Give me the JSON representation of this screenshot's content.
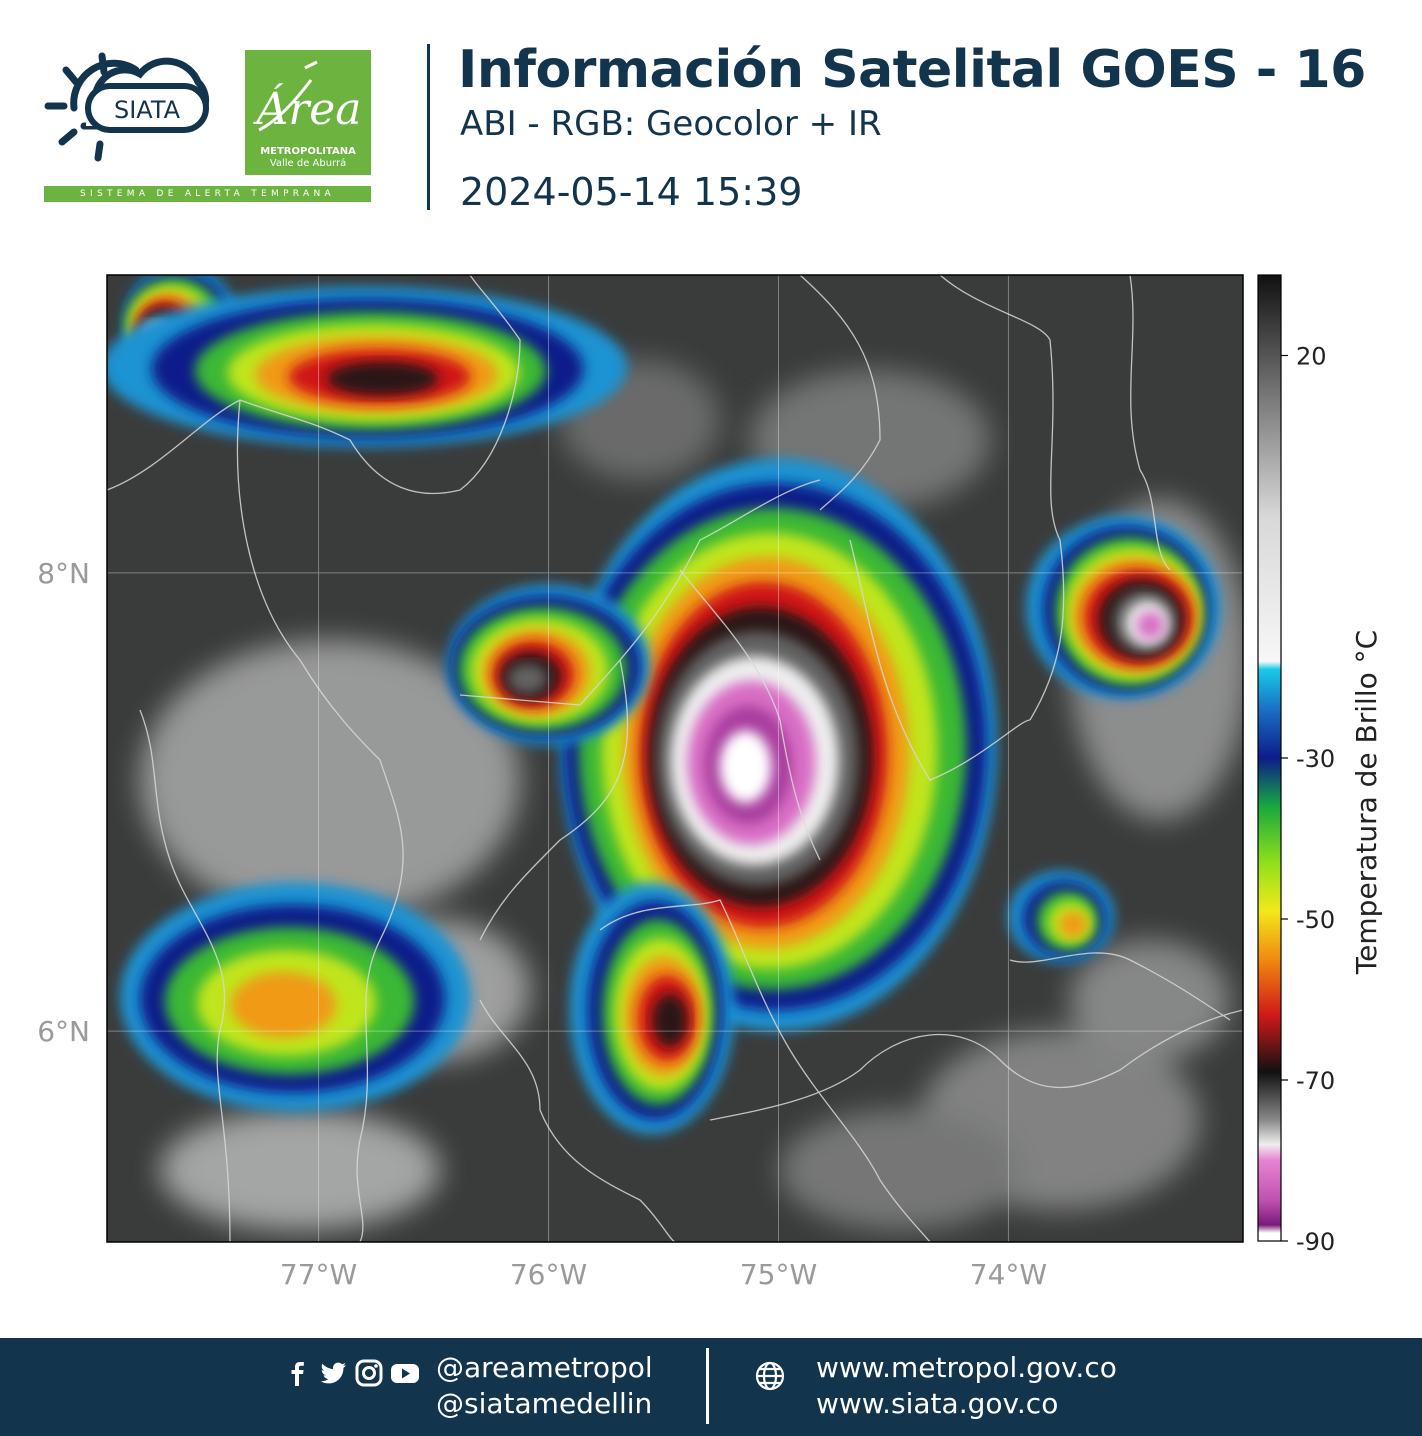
{
  "header": {
    "siata_logo_text": "SIATA",
    "area_logo_word": "Área",
    "area_logo_line1": "METROPOLITANA",
    "area_logo_line2": "Valle de Aburrá",
    "slogan": "SISTEMA DE ALERTA TEMPRANA",
    "title": "Información Satelital GOES - 16",
    "subtitle": "ABI - RGB: Geocolor + IR",
    "datetime": "2024-05-14 15:39"
  },
  "map": {
    "lon_range": [
      -77.92,
      -72.98
    ],
    "lat_range": [
      5.08,
      9.3
    ],
    "x_ticks": [
      {
        "value": -77,
        "label": "77°W"
      },
      {
        "value": -76,
        "label": "76°W"
      },
      {
        "value": -75,
        "label": "75°W"
      },
      {
        "value": -74,
        "label": "74°W"
      }
    ],
    "y_ticks": [
      {
        "value": 8,
        "label": "8°N"
      },
      {
        "value": 6,
        "label": "6°N"
      }
    ],
    "grid": true,
    "cloud_cells": [
      {
        "lon": -75.0,
        "lat": 7.25,
        "rx": 0.95,
        "ry": 1.25,
        "min_temp": -90
      },
      {
        "lon": -73.5,
        "lat": 7.85,
        "rx": 0.42,
        "ry": 0.4,
        "min_temp": -85
      },
      {
        "lon": -76.0,
        "lat": 7.6,
        "rx": 0.45,
        "ry": 0.35,
        "min_temp": -75
      },
      {
        "lon": -75.55,
        "lat": 6.1,
        "rx": 0.35,
        "ry": 0.55,
        "min_temp": -72
      },
      {
        "lon": -77.6,
        "lat": 9.1,
        "rx": 0.25,
        "ry": 0.25,
        "min_temp": -85
      },
      {
        "lon": -76.8,
        "lat": 8.9,
        "rx": 1.1,
        "ry": 0.35,
        "min_temp": -70
      },
      {
        "lon": -77.1,
        "lat": 6.15,
        "rx": 0.8,
        "ry": 0.5,
        "min_temp": -55
      },
      {
        "lon": -73.77,
        "lat": 6.5,
        "rx": 0.22,
        "ry": 0.2,
        "min_temp": -55
      }
    ]
  },
  "colorbar": {
    "title": "Temperatura de Brillo °C",
    "min": -90,
    "max": 30,
    "ticks": [
      {
        "value": 20,
        "label": "20"
      },
      {
        "value": -30,
        "label": "-30"
      },
      {
        "value": -50,
        "label": "-50"
      },
      {
        "value": -70,
        "label": "-70"
      },
      {
        "value": -90,
        "label": "-90"
      }
    ],
    "stops": [
      {
        "value": 30,
        "color": "#111111"
      },
      {
        "value": 15,
        "color": "#777777"
      },
      {
        "value": 0,
        "color": "#d8d8d8"
      },
      {
        "value": -18,
        "color": "#f7f7f7"
      },
      {
        "value": -19,
        "color": "#19c9e8"
      },
      {
        "value": -24,
        "color": "#1a6fc4"
      },
      {
        "value": -30,
        "color": "#0b1d8a"
      },
      {
        "value": -36,
        "color": "#18a840"
      },
      {
        "value": -43,
        "color": "#8ee01a"
      },
      {
        "value": -49,
        "color": "#f2e91a"
      },
      {
        "value": -55,
        "color": "#f08a10"
      },
      {
        "value": -62,
        "color": "#d01818"
      },
      {
        "value": -69,
        "color": "#111111"
      },
      {
        "value": -75,
        "color": "#8a8a8a"
      },
      {
        "value": -78,
        "color": "#eeeeee"
      },
      {
        "value": -80,
        "color": "#e882d2"
      },
      {
        "value": -85,
        "color": "#c050b0"
      },
      {
        "value": -88,
        "color": "#7a1a7a"
      },
      {
        "value": -89,
        "color": "#ffffff"
      },
      {
        "value": -90,
        "color": "#ffffff"
      }
    ]
  },
  "footer": {
    "handle1": "@areametropol",
    "handle2": "@siatamedellin",
    "web1": "www.metropol.gov.co",
    "web2": "www.siata.gov.co"
  },
  "colors": {
    "navy": "#12344d",
    "green": "#6db33f"
  }
}
